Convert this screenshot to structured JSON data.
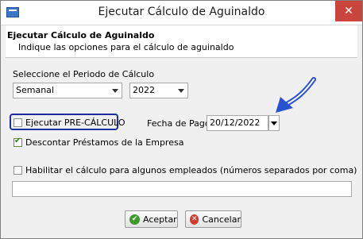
{
  "window": {
    "title": "Ejecutar Cálculo de Aguinaldo",
    "close_glyph": "✕"
  },
  "header": {
    "title": "Ejecutar Cálculo de Aguinaldo",
    "subtitle": "Indique las opciones para el cálculo de aguinaldo"
  },
  "period": {
    "label": "Seleccione el Periodo de Cálculo",
    "frequency_value": "Semanal",
    "year_value": "2022"
  },
  "options": {
    "precalculo_label": "Ejecutar PRE-CÁLCULO",
    "precalculo_checked": false,
    "fecha_pago_label": "Fecha de Pago",
    "fecha_pago_value": "20/12/2022",
    "descontar_label": "Descontar Préstamos de la Empresa",
    "descontar_checked": true,
    "habilitar_label": "Habilitar el cálculo para algunos empleados (números separados por coma)",
    "habilitar_checked": false,
    "empleados_value": ""
  },
  "buttons": {
    "accept_label": "Aceptar",
    "cancel_label": "Cancelar"
  },
  "colors": {
    "highlight_border": "#1a2fa0",
    "close_button": "#c9453b",
    "pointer_arrow": "#2a52d0"
  },
  "icons": {
    "app": "app-icon",
    "accept": "check-circle-icon",
    "cancel": "x-circle-icon",
    "pointer": "pointer-arrow-icon"
  }
}
